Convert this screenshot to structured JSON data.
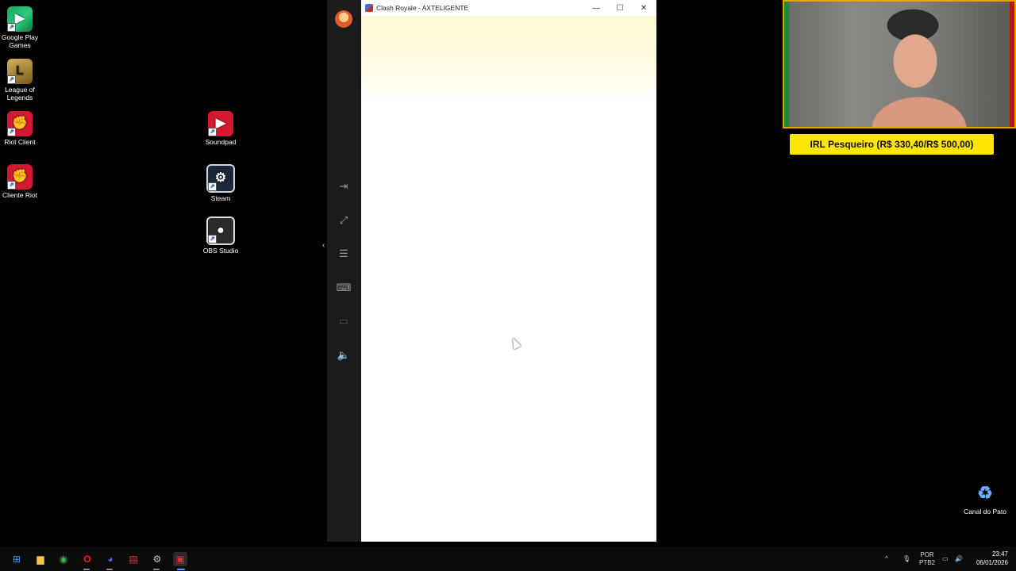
{
  "desktop": {
    "icons": [
      {
        "label": "Google Play Games",
        "glyph": "▶",
        "name": "google-play-games-icon"
      },
      {
        "label": "League of Legends",
        "glyph": "L",
        "name": "league-of-legends-icon"
      },
      {
        "label": "Riot Client",
        "glyph": "✊",
        "name": "riot-client-icon"
      },
      {
        "label": "Cliente Riot",
        "glyph": "✊",
        "name": "cliente-riot-icon"
      },
      {
        "label": "Soundpad",
        "glyph": "▶",
        "name": "soundpad-icon"
      },
      {
        "label": "Steam",
        "glyph": "⚙",
        "name": "steam-icon"
      },
      {
        "label": "OBS Studio",
        "glyph": "●",
        "name": "obs-studio-icon"
      },
      {
        "label": "Canal do Pato",
        "glyph": "♻",
        "name": "recycle-bin-icon"
      }
    ]
  },
  "emulator": {
    "window_title": "Clash Royale - AXTELIGENTE",
    "controls": {
      "minimize": "—",
      "maximize": "☐",
      "close": "✕"
    },
    "sidebar_icons": [
      "exit-icon",
      "expand-icon",
      "sliders-icon",
      "keyboard-icon",
      "tag-icon",
      "volume-icon"
    ],
    "sidebar_glyphs": [
      "⇥",
      "⤢",
      "☰",
      "⌨",
      "▭",
      "🔈"
    ],
    "collapse_glyph": "‹"
  },
  "overlay": {
    "goal_text": "IRL Pesqueiro (R$ 330,40/R$ 500,00)",
    "goal_progress": 0.66
  },
  "taskbar": {
    "apps": [
      {
        "name": "windows-start-icon",
        "glyph": "⊞",
        "color": "#3aa0ff"
      },
      {
        "name": "file-explorer-icon",
        "glyph": "▆",
        "color": "#f4c542"
      },
      {
        "name": "chrome-icon",
        "glyph": "◉",
        "color": "#4caf50"
      },
      {
        "name": "opera-icon",
        "glyph": "O",
        "color": "#ff1b2d"
      },
      {
        "name": "discord-icon",
        "glyph": "◕",
        "color": "#5865f2"
      },
      {
        "name": "app-news-icon",
        "glyph": "▤",
        "color": "#e53935"
      },
      {
        "name": "steelseries-icon",
        "glyph": "⚙",
        "color": "#cccccc"
      },
      {
        "name": "emulator-taskbar-icon",
        "glyph": "▣",
        "color": "#d33"
      }
    ],
    "tray": {
      "chevron": "^",
      "mic": "🎙",
      "lang_line1": "POR",
      "lang_line2": "PTB2",
      "network": "▭",
      "volume": "🔊"
    },
    "time": "23:47",
    "date": "06/01/2026"
  }
}
